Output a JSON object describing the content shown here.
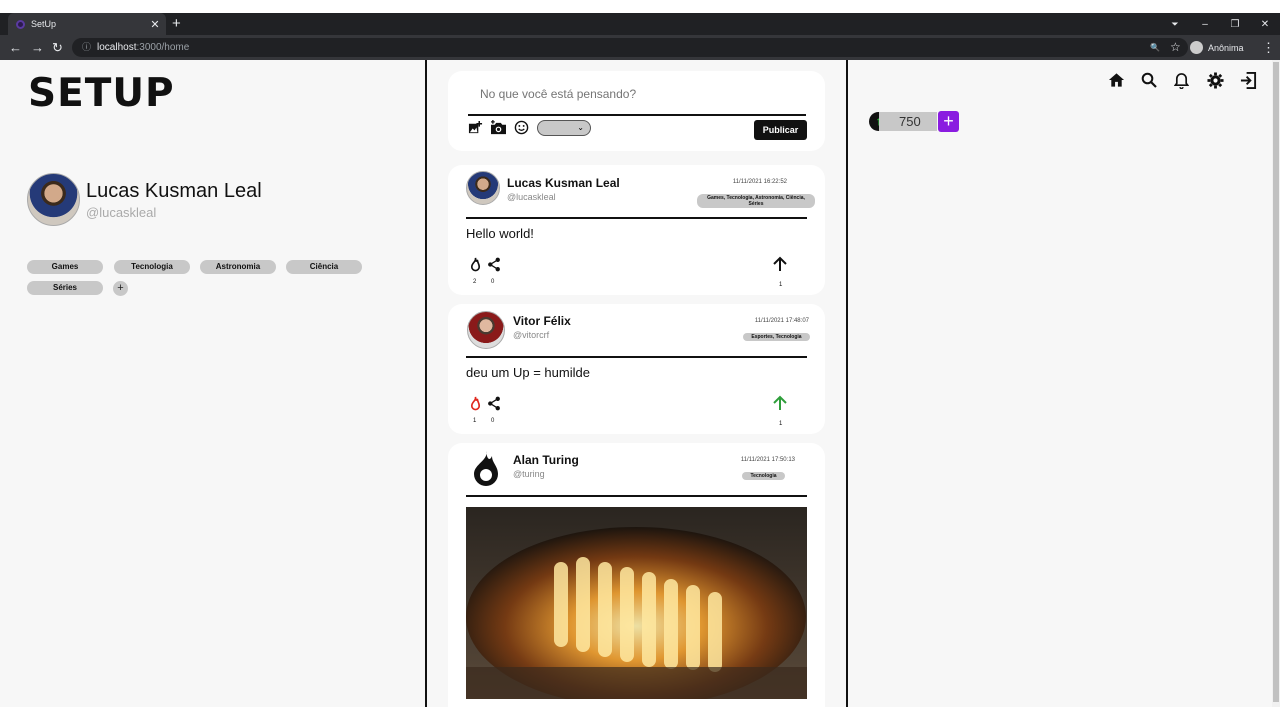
{
  "browser": {
    "tab_title": "SetUp",
    "tab_close": "✕",
    "new_tab": "+",
    "url_host": "localhost",
    "url_path": ":3000/home",
    "profile_label": "Anônima",
    "controls": {
      "minimize": "–",
      "restore": "❐",
      "close": "✕"
    },
    "nav": {
      "back": "←",
      "forward": "→",
      "reload": "↻"
    },
    "icons": {
      "zoom": "🔍",
      "star": "☆",
      "menu": "⋮",
      "info": "ⓘ"
    }
  },
  "app": {
    "logo": "SETUP",
    "user": {
      "name": "Lucas Kusman Leal",
      "handle": "@lucaskleal"
    },
    "tags": [
      "Games",
      "Tecnologia",
      "Astronomia",
      "Ciência",
      "Séries"
    ],
    "add_tag": "+",
    "composer": {
      "placeholder": "No que você está pensando?",
      "publish": "Publicar",
      "icons": [
        "add-photo-icon",
        "camera-icon",
        "emoji-icon"
      ]
    },
    "posts": [
      {
        "name": "Lucas Kusman Leal",
        "handle": "@lucaskleal",
        "date": "11/11/2021 16:22:52",
        "tags": "Games, Tecnologia, Astronomia, Ciência, Séries",
        "text": "Hello world!",
        "fire": "2",
        "share": "0",
        "ups": "1",
        "fire_active": false,
        "up_active": false
      },
      {
        "name": "Vitor Félix",
        "handle": "@vitorcrf",
        "date": "11/11/2021 17:48:07",
        "tags": "Esportes, Tecnologia",
        "text": "deu um Up = humilde",
        "fire": "1",
        "share": "0",
        "ups": "1",
        "fire_active": true,
        "up_active": true
      },
      {
        "name": "Alan Turing",
        "handle": "@turing",
        "date": "11/11/2021 17:50:13",
        "tags": "Tecnologia",
        "text": "",
        "fire": "",
        "share": "",
        "ups": "",
        "fire_active": true,
        "up_active": false
      }
    ],
    "points": {
      "value": "750",
      "add": "+"
    },
    "colors": {
      "accent": "#8a1ce0",
      "up_green": "#2e9e3a",
      "fire_red": "#e0281e"
    }
  }
}
